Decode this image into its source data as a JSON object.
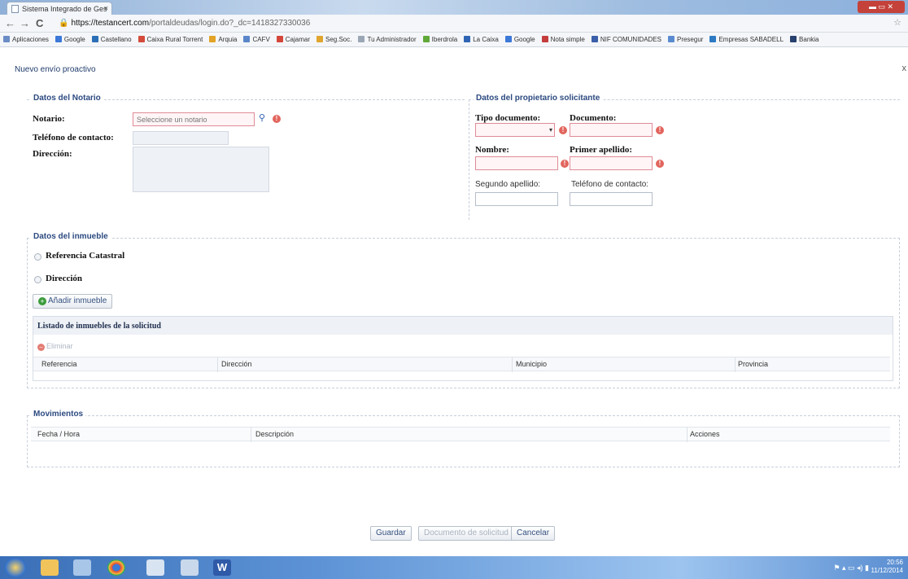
{
  "browser": {
    "tab_title": "Sistema Integrado de Ges",
    "tab_close": "×",
    "url_host": "https://testancert.com",
    "url_path": "/portaldeudas/login.do?_dc=1418327330036",
    "bookmarks": [
      {
        "label": "Aplicaciones",
        "color": "#6b8cc7"
      },
      {
        "label": "Google",
        "color": "#3b78d8"
      },
      {
        "label": "Castellano",
        "color": "#2d6fb6"
      },
      {
        "label": "Caixa Rural Torrent",
        "color": "#d44b3b"
      },
      {
        "label": "Arquia",
        "color": "#e2a326"
      },
      {
        "label": "CAFV",
        "color": "#5a86c9"
      },
      {
        "label": "Cajamar",
        "color": "#d5463a"
      },
      {
        "label": "Seg.Soc.",
        "color": "#e0a52f"
      },
      {
        "label": "Tu Administrador",
        "color": "#9aa6b4"
      },
      {
        "label": "Iberdrola",
        "color": "#61a83a"
      },
      {
        "label": "La Caixa",
        "color": "#2f64b5"
      },
      {
        "label": "Google",
        "color": "#3b78d8"
      },
      {
        "label": "Nota simple",
        "color": "#c43c3c"
      },
      {
        "label": "NIF COMUNIDADES",
        "color": "#3b5fa8"
      },
      {
        "label": "Presegur",
        "color": "#5a8bd0"
      },
      {
        "label": "Empresas SABADELL",
        "color": "#2d7ac2"
      },
      {
        "label": "Bankia",
        "color": "#27406e"
      }
    ]
  },
  "dialog": {
    "title": "Nuevo envío proactivo",
    "close": "x"
  },
  "notario": {
    "legend": "Datos del Notario",
    "notario_label": "Notario:",
    "notario_placeholder": "Seleccione un notario",
    "telefono_label": "Teléfono de contacto:",
    "direccion_label": "Dirección:"
  },
  "propietario": {
    "legend": "Datos del propietario solicitante",
    "tipo_documento_label": "Tipo documento:",
    "documento_label": "Documento:",
    "nombre_label": "Nombre:",
    "primer_apellido_label": "Primer apellido:",
    "segundo_apellido_label": "Segundo apellido:",
    "telefono_label": "Teléfono de contacto:"
  },
  "inmueble": {
    "legend": "Datos del inmueble",
    "radio_referencia": "Referencia Catastral",
    "radio_direccion": "Dirección",
    "add_button": "Añadir inmueble",
    "list_title": "Listado de inmuebles de la solicitud",
    "eliminar": "Eliminar",
    "columns": [
      "Referencia",
      "Dirección",
      "Municipio",
      "Provincia"
    ]
  },
  "movimientos": {
    "legend": "Movimientos",
    "columns": [
      "Fecha / Hora",
      "Descripción",
      "Acciones"
    ]
  },
  "footer_buttons": {
    "guardar": "Guardar",
    "documento": "Documento de solicitud",
    "cancelar": "Cancelar"
  },
  "taskbar": {
    "time": "20:56",
    "date": "11/12/2014"
  }
}
